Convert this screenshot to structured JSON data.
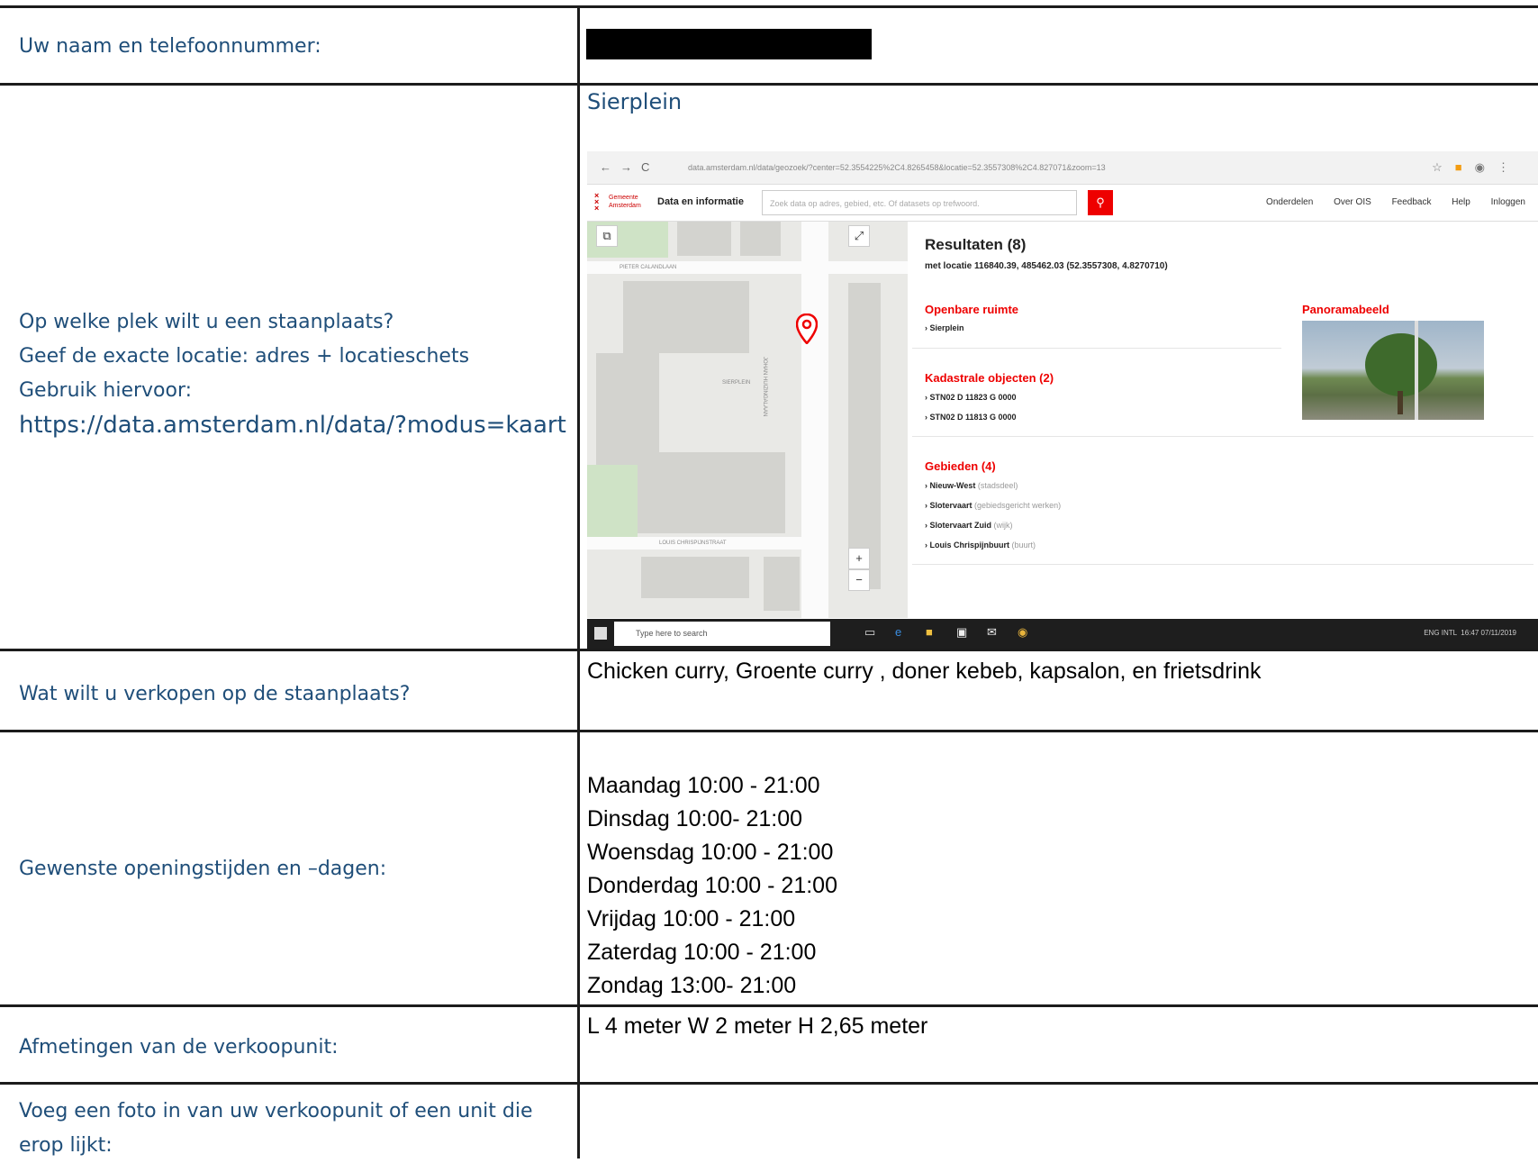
{
  "form": {
    "row1": {
      "label": "Uw naam en telefoonnummer:"
    },
    "row2": {
      "label_lines": [
        "Op welke plek wilt u een staanplaats?",
        "Geef de exacte locatie: adres + locatieschets",
        "Gebruik hiervoor:"
      ],
      "url": "https://data.amsterdam.nl/data/?modus=kaart",
      "answer": "Sierplein"
    },
    "row3": {
      "label": "Wat wilt u verkopen op de staanplaats?",
      "answer": "Chicken curry, Groente curry , doner kebeb, kapsalon, en frietsdrink"
    },
    "row4": {
      "label": "Gewenste openingstijden en –dagen:",
      "hours": [
        "Maandag 10:00 - 21:00",
        "Dinsdag 10:00- 21:00",
        "Woensdag 10:00 - 21:00",
        "Donderdag 10:00 - 21:00",
        "Vrijdag 10:00 - 21:00",
        "Zaterdag 10:00 - 21:00",
        "Zondag 13:00- 21:00"
      ]
    },
    "row5": {
      "label": "Afmetingen van de verkoopunit:",
      "answer": "L 4 meter W 2 meter H 2,65 meter"
    },
    "row6": {
      "label_lines": [
        "Voeg een foto in van uw verkoopunit of een unit die",
        "erop lijkt:"
      ]
    }
  },
  "screenshot": {
    "address": "data.amsterdam.nl/data/geozoek/?center=52.3554225%2C4.8265458&locatie=52.3557308%2C4.827071&zoom=13",
    "logo_text": [
      "Gemeente",
      "Amsterdam"
    ],
    "app_title": "Data en informatie",
    "search_placeholder": "Zoek data op adres, gebied, etc. Of datasets op trefwoord.",
    "menu": [
      "Onderdelen",
      "Over OIS",
      "Feedback",
      "Help",
      "Inloggen"
    ],
    "street_labels": [
      "PIETER CALANDLAAN",
      "SIERPLEIN",
      "LOUIS CHRISPIJNSTRAAT",
      "JOHAN HUIZINGALAAN"
    ],
    "results_title": "Resultaten (8)",
    "results_location": "met locatie 116840.39, 485462.03 (52.3557308, 4.8270710)",
    "openbare_ruimte": {
      "heading": "Openbare ruimte",
      "items": [
        "Sierplein"
      ]
    },
    "panorama": {
      "heading": "Panoramabeeld"
    },
    "kadastrale": {
      "heading": "Kadastrale objecten (2)",
      "items": [
        "STN02 D 11823 G 0000",
        "STN02 D 11813 G 0000"
      ]
    },
    "gebieden": {
      "heading": "Gebieden (4)",
      "items": [
        {
          "name": "Nieuw-West",
          "note": "(stadsdeel)"
        },
        {
          "name": "Slotervaart",
          "note": "(gebiedsgericht werken)"
        },
        {
          "name": "Slotervaart Zuid",
          "note": "(wijk)"
        },
        {
          "name": "Louis Chrispijnbuurt",
          "note": "(buurt)"
        }
      ]
    },
    "taskbar": {
      "search": "Type here to search",
      "lang": "ENG",
      "lang2": "INTL",
      "time": "16:47",
      "date": "07/11/2019"
    }
  },
  "colors": {
    "label": "#1f4e79",
    "accent_red": "#e00000",
    "border": "#1c1c1c"
  }
}
